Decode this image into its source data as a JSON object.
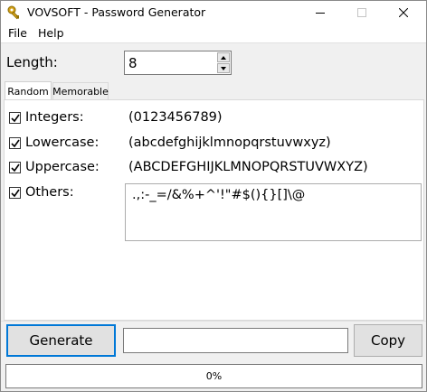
{
  "window": {
    "title": "VOVSOFT - Password Generator"
  },
  "menu": {
    "file": "File",
    "help": "Help"
  },
  "length": {
    "label": "Length:",
    "value": "8"
  },
  "tabs": [
    {
      "label": "Random",
      "active": true
    },
    {
      "label": "Memorable",
      "active": false
    }
  ],
  "options": {
    "integers": {
      "label": "Integers:",
      "chars": "(0123456789)",
      "checked": true
    },
    "lowercase": {
      "label": "Lowercase:",
      "chars": "(abcdefghijklmnopqrstuvwxyz)",
      "checked": true
    },
    "uppercase": {
      "label": "Uppercase:",
      "chars": "(ABCDEFGHIJKLMNOPQRSTUVWXYZ)",
      "checked": true
    },
    "others": {
      "label": "Others:",
      "chars": ".,:-_=/&%+^'!\"#$(){}[]\\@",
      "checked": true
    }
  },
  "actions": {
    "generate": "Generate",
    "copy": "Copy",
    "output": ""
  },
  "progress": {
    "percent": 0,
    "text": "0%"
  },
  "colors": {
    "accent": "#0078d7",
    "progress": "#06b025",
    "icon": "#d4a017"
  },
  "icons": {
    "app": "key-icon",
    "minimize": "minimize-icon",
    "maximize": "maximize-icon",
    "close": "close-icon",
    "check": "checkmark-icon"
  }
}
